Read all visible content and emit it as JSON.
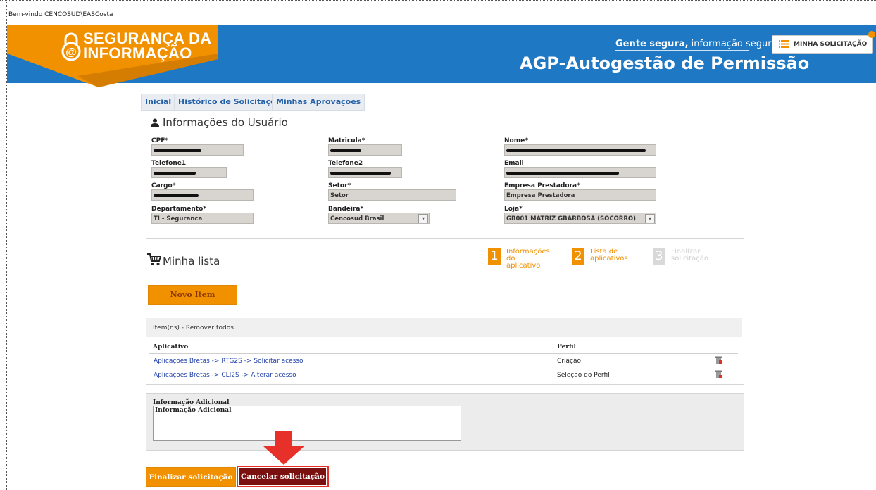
{
  "welcome": "Bem-vindo CENCOSUD\\EASCosta",
  "header": {
    "logo_line1": "SEGURANÇA DA",
    "logo_line2": "INFORMAÇÃO",
    "tagline_bold": "Gente segura,",
    "tagline_rest": " informação segura",
    "title": "AGP-Autogestão de Permissão",
    "minha_solicitacao": "MINHA SOLICITAÇÃO",
    "accent": "#f29100",
    "brand_blue": "#1e78c3"
  },
  "nav": [
    "Inicial",
    "Histórico de Solicitações",
    "Minhas Aprovações"
  ],
  "user_section": {
    "title": "Informações do Usuário",
    "fields": {
      "cpf": {
        "label": "CPF*",
        "value": ""
      },
      "matricula": {
        "label": "Matricula*",
        "value": ""
      },
      "nome": {
        "label": "Nome*",
        "value": ""
      },
      "telefone1": {
        "label": "Telefone1",
        "value": ""
      },
      "telefone2": {
        "label": "Telefone2",
        "value": ""
      },
      "email": {
        "label": "Email",
        "value": ""
      },
      "cargo": {
        "label": "Cargo*",
        "value": ""
      },
      "setor": {
        "label": "Setor*",
        "value": "Setor"
      },
      "empresa": {
        "label": "Empresa Prestadora*",
        "value": "Empresa Prestadora"
      },
      "departamento": {
        "label": "Departamento*",
        "value": "TI - Seguranca"
      },
      "bandeira": {
        "label": "Bandeira*",
        "value": "Cencosud Brasil"
      },
      "loja": {
        "label": "Loja*",
        "value": "GB001 MATRIZ GBARBOSA (SOCORRO)"
      }
    }
  },
  "lista": {
    "title": "Minha lista",
    "steps": [
      {
        "num": "1",
        "line1": "Informações",
        "line2": "do aplicativo",
        "state": "active"
      },
      {
        "num": "2",
        "line1": "Lista de",
        "line2": "aplicativos",
        "state": "active"
      },
      {
        "num": "3",
        "line1": "Finalizar",
        "line2": "solicitação",
        "state": "inactive"
      }
    ],
    "novo_item": "Novo Item"
  },
  "items": {
    "header": "Item(ns) - Remover todos",
    "col_aplicativo": "Aplicativo",
    "col_perfil": "Perfil",
    "rows": [
      {
        "aplicativo": "Aplicações Bretas -> RTG2S -> Solicitar acesso",
        "perfil": "Criação"
      },
      {
        "aplicativo": "Aplicações Bretas -> CLI2S -> Alterar acesso",
        "perfil": "Seleção do Perfil"
      }
    ]
  },
  "adicional": {
    "label": "Informação Adicional",
    "value": "Informação Adicional"
  },
  "actions": {
    "finalizar": "Finalizar solicitação",
    "cancelar": "Cancelar solicitação"
  }
}
